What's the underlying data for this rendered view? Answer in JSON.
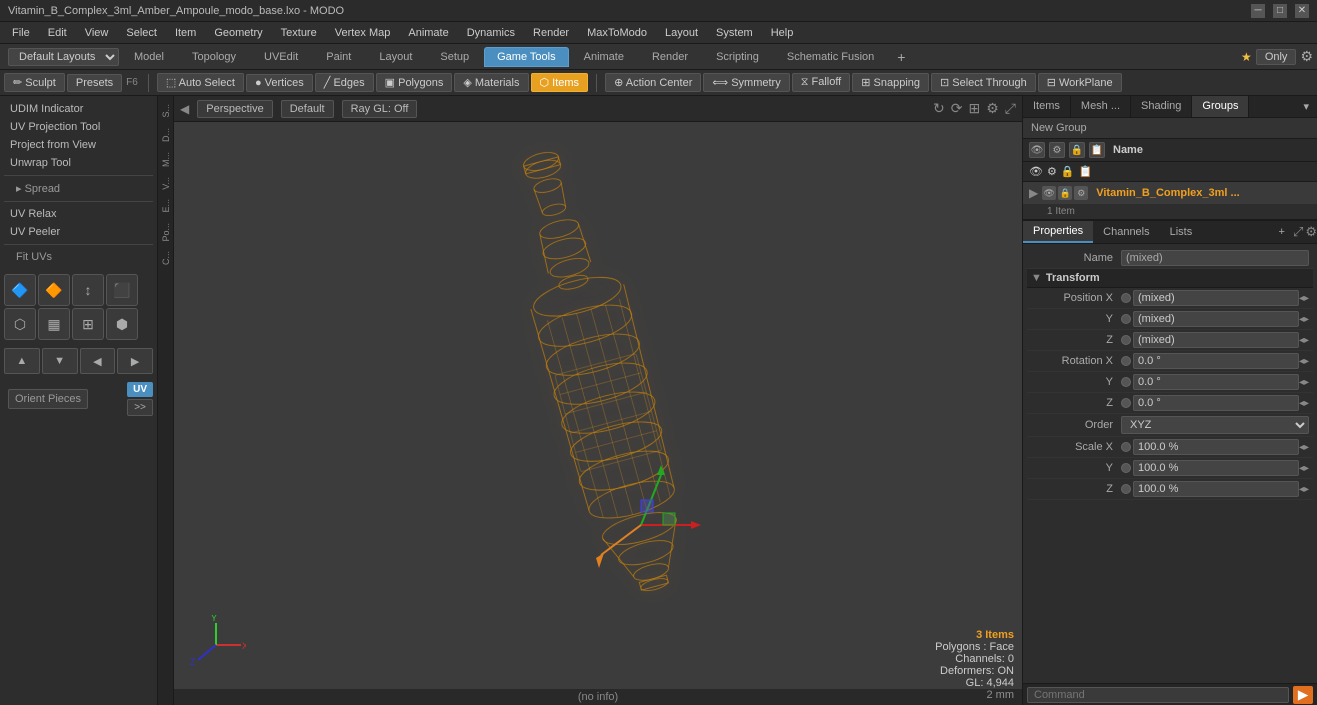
{
  "window": {
    "title": "Vitamin_B_Complex_3ml_Amber_Ampoule_modo_base.lxo - MODO"
  },
  "menubar": {
    "items": [
      "File",
      "Edit",
      "View",
      "Select",
      "Item",
      "Geometry",
      "Texture",
      "Vertex Map",
      "Animate",
      "Dynamics",
      "Render",
      "MaxToModo",
      "Layout",
      "System",
      "Help"
    ]
  },
  "tabbar": {
    "layout_label": "Default Layouts",
    "tabs": [
      "Model",
      "Topology",
      "UVEdit",
      "Paint",
      "Layout",
      "Setup",
      "Game Tools",
      "Animate",
      "Render",
      "Scripting",
      "Schematic Fusion"
    ],
    "active_tab": "Game Tools",
    "add_label": "+",
    "star": "★",
    "only_label": "Only"
  },
  "toolbar": {
    "sculpt_label": "Sculpt",
    "presets_label": "Presets",
    "f6_label": "F6",
    "auto_select_label": "Auto Select",
    "vertices_label": "Vertices",
    "edges_label": "Edges",
    "polygons_label": "Polygons",
    "materials_label": "Materials",
    "items_label": "Items",
    "action_center_label": "Action Center",
    "symmetry_label": "Symmetry",
    "falloff_label": "Falloff",
    "snapping_label": "Snapping",
    "select_through_label": "Select Through",
    "workplane_label": "WorkPlane"
  },
  "left_panel": {
    "items": [
      "UDIM Indicator",
      "UV Projection Tool",
      "Project from View",
      "Unwrap Tool",
      "Spread",
      "UV Relax",
      "UV Peeler",
      "Fit UVs",
      "Orient Pieces"
    ],
    "spread_prefix": "▸",
    "uv_badge": "UV",
    "expand_btn": ">>"
  },
  "viewport": {
    "camera_label": "Perspective",
    "shading_label": "Default",
    "raygl_label": "Ray GL: Off",
    "status_items": "3 Items",
    "status_polygons": "Polygons : Face",
    "status_channels": "Channels: 0",
    "status_deformers": "Deformers: ON",
    "status_gl": "GL: 4,944",
    "status_size": "2 mm",
    "no_info": "(no info)"
  },
  "right_panel": {
    "tabs": [
      "Items",
      "Mesh ...",
      "Shading",
      "Groups"
    ],
    "active_tab": "Groups",
    "new_group_label": "New Group",
    "name_label": "Name",
    "list_icons": [
      "👁",
      "⚙",
      "🔒",
      "📋"
    ],
    "item_name": "Vitamin_B_Complex_3ml ...",
    "item_count": "1 Item",
    "item_icon": "▶"
  },
  "properties": {
    "tabs": [
      "Properties",
      "Channels",
      "Lists"
    ],
    "active_tab": "Properties",
    "add_label": "+",
    "name_label": "Name",
    "name_value": "(mixed)",
    "transform_section": "Transform",
    "fields": [
      {
        "label": "Position X",
        "value": "(mixed)",
        "has_dot": true,
        "dot_color": "default"
      },
      {
        "label": "Y",
        "value": "(mixed)",
        "has_dot": true,
        "dot_color": "default"
      },
      {
        "label": "Z",
        "value": "(mixed)",
        "has_dot": true,
        "dot_color": "default"
      },
      {
        "label": "Rotation X",
        "value": "0.0 °",
        "has_dot": true,
        "dot_color": "default"
      },
      {
        "label": "Y",
        "value": "0.0 °",
        "has_dot": true,
        "dot_color": "default"
      },
      {
        "label": "Z",
        "value": "0.0 °",
        "has_dot": true,
        "dot_color": "default"
      },
      {
        "label": "Order",
        "value": "XYZ",
        "has_dot": false,
        "is_select": true
      },
      {
        "label": "Scale X",
        "value": "100.0 %",
        "has_dot": true,
        "dot_color": "default"
      },
      {
        "label": "Y",
        "value": "100.0 %",
        "has_dot": true,
        "dot_color": "default"
      },
      {
        "label": "Z",
        "value": "100.0 %",
        "has_dot": true,
        "dot_color": "default"
      }
    ]
  },
  "cmdbar": {
    "placeholder": "Command",
    "execute_icon": "▶"
  },
  "colors": {
    "active_tab": "#4a8fc0",
    "item_name": "#f0a020",
    "orange_btn": "#e07020"
  }
}
